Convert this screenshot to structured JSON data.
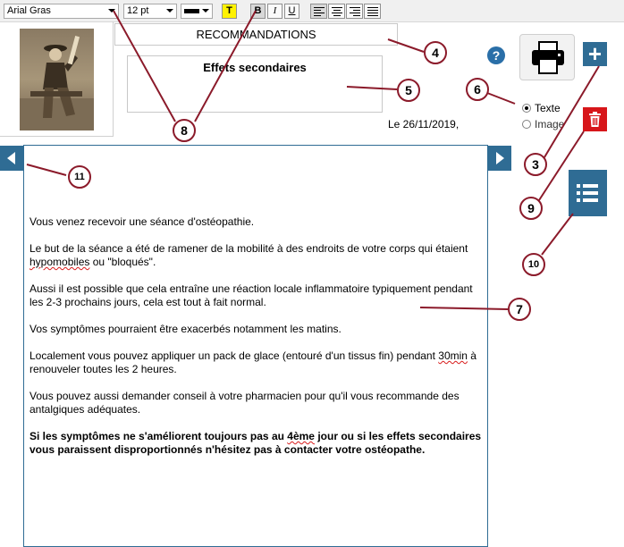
{
  "toolbar": {
    "font_family": "Arial Gras",
    "font_size": "12 pt",
    "text_color": "#000000",
    "highlight_label": "T",
    "bold_label": "B",
    "italic_label": "I",
    "underline_label": "U"
  },
  "header": {
    "title": "RECOMMANDATIONS",
    "subtitle": "Effets secondaires",
    "date": "Le 26/11/2019,"
  },
  "mode": {
    "options": [
      "Texte",
      "Image"
    ],
    "selected": "Texte"
  },
  "icons": {
    "help": "question-circle-icon",
    "print": "printer-icon",
    "add": "plus-icon",
    "delete": "trash-icon",
    "list": "list-icon",
    "prev": "chevron-left-icon",
    "next": "chevron-right-icon",
    "help_glyph": "?",
    "add_glyph": "+"
  },
  "colors": {
    "accent": "#2f6c94",
    "danger": "#d7161a",
    "callout": "#8b1a2a"
  },
  "editor": {
    "p1": "Vous venez recevoir une séance d'ostéopathie.",
    "p2_a": "Le but de la séance a été de ramener de la mobilité à des endroits de votre corps qui étaient ",
    "p2_b": "hypomobiles",
    "p2_c": " ou \"bloqués\".",
    "p3": "Aussi il est possible que cela entraîne une réaction locale inflammatoire typiquement pendant les 2-3 prochains jours, cela est tout à fait normal.",
    "p4": "Vos symptômes pourraient être exacerbés notamment les matins.",
    "p5_a": "Localement vous pouvez appliquer un pack de glace (entouré d'un tissus fin) pendant ",
    "p5_b": "30min",
    "p5_c": " à renouveler toutes les 2 heures.",
    "p6": "Vous pouvez aussi demander conseil à votre pharmacien pour qu'il vous recommande des antalgiques adéquates.",
    "p7_a": "Si les symptômes ne s'améliorent toujours pas au ",
    "p7_b": "4ème",
    "p7_c": " jour ou si les effets secondaires vous paraissent disproportionnés n'hésitez pas à contacter votre ostéopathe."
  },
  "callouts": [
    "3",
    "4",
    "5",
    "6",
    "7",
    "8",
    "9",
    "10",
    "11"
  ]
}
